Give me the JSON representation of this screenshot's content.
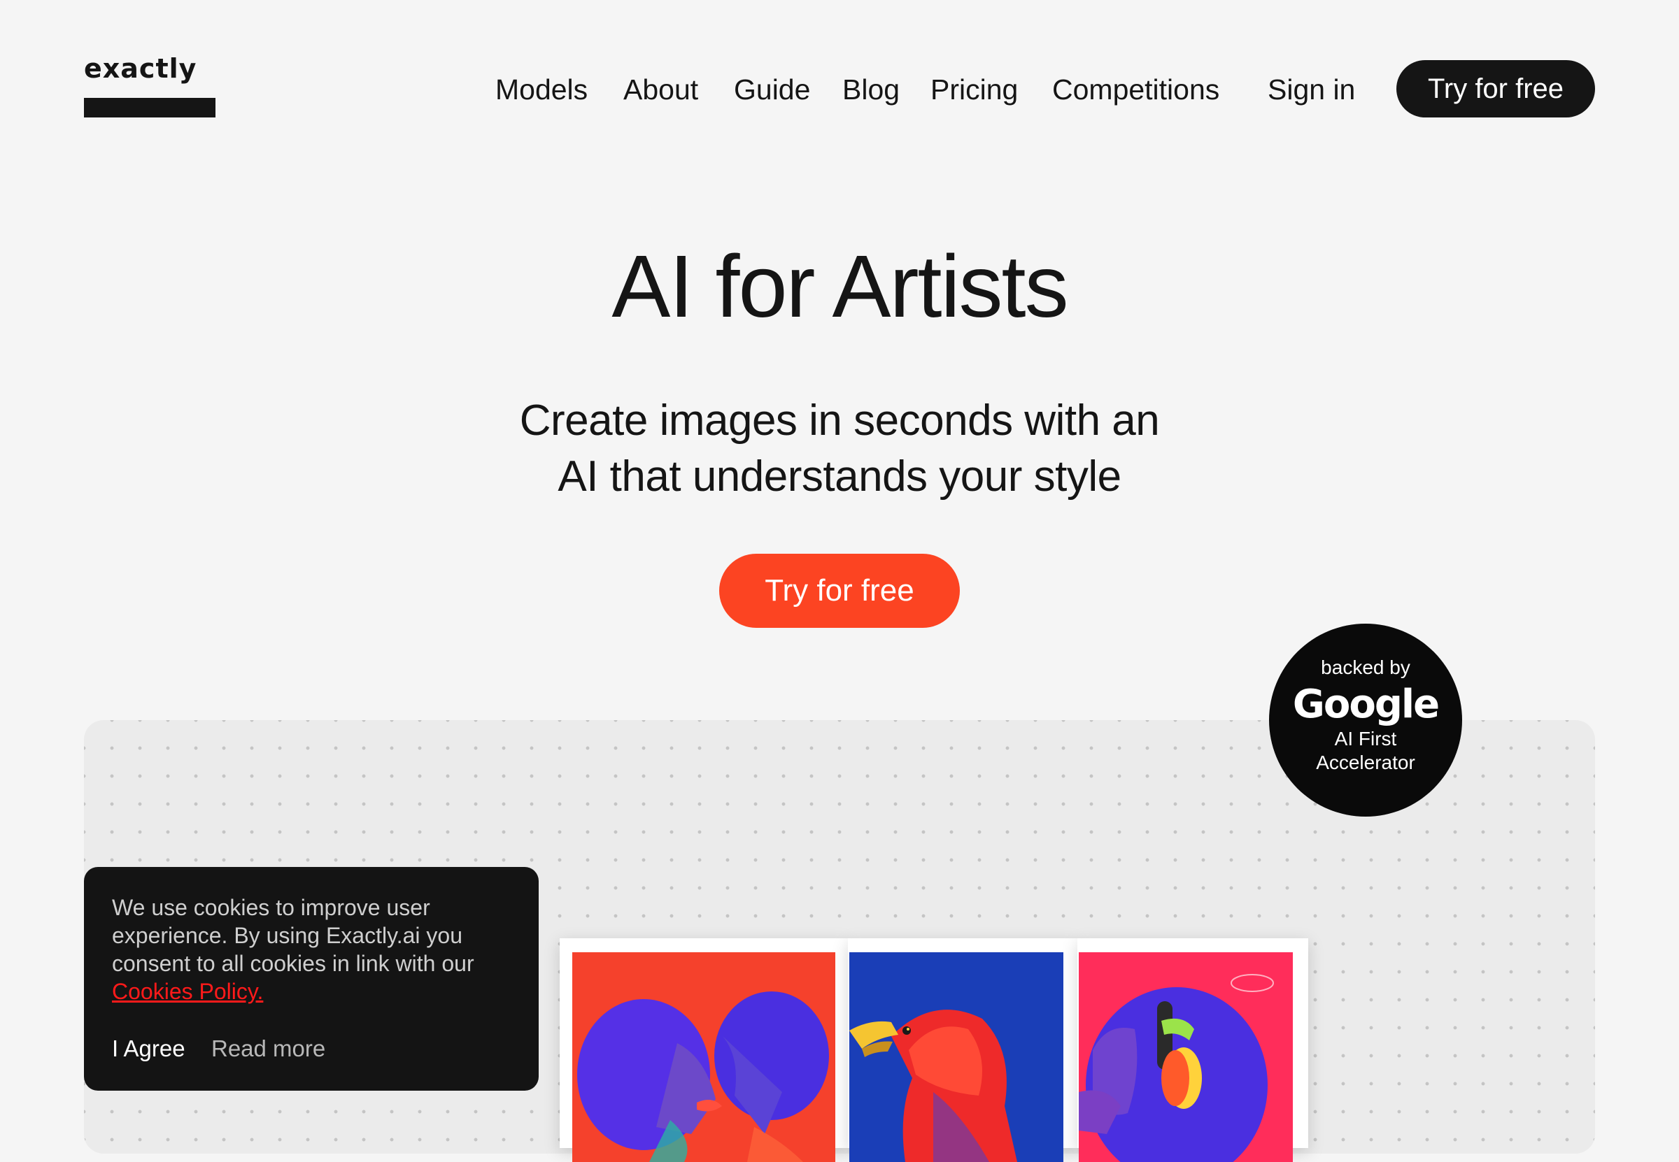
{
  "header": {
    "logo_text": "exactly",
    "nav": [
      {
        "label": "Models"
      },
      {
        "label": "About"
      },
      {
        "label": "Guide"
      },
      {
        "label": "Blog"
      },
      {
        "label": "Pricing"
      },
      {
        "label": "Competitions"
      },
      {
        "label": "Sign in"
      }
    ],
    "cta_label": "Try for free"
  },
  "hero": {
    "title": "AI for Artists",
    "subtitle_line1": "Create images in seconds with an",
    "subtitle_line2": "AI that understands your style",
    "cta_label": "Try for free"
  },
  "badge": {
    "top": "backed by",
    "brand": "Google",
    "line1": "AI First",
    "line2": "Accelerator"
  },
  "cookie": {
    "text": "We use cookies to improve user experience. By using Exactly.ai you consent to all cookies in link with our",
    "link_label": "Cookies Policy.",
    "agree_label": "I Agree",
    "read_more_label": "Read more"
  },
  "colors": {
    "background": "#f5f5f5",
    "text": "#151515",
    "accent": "#fc4422",
    "cookie_bg": "#141414",
    "cookie_link": "#ff1a1a"
  }
}
